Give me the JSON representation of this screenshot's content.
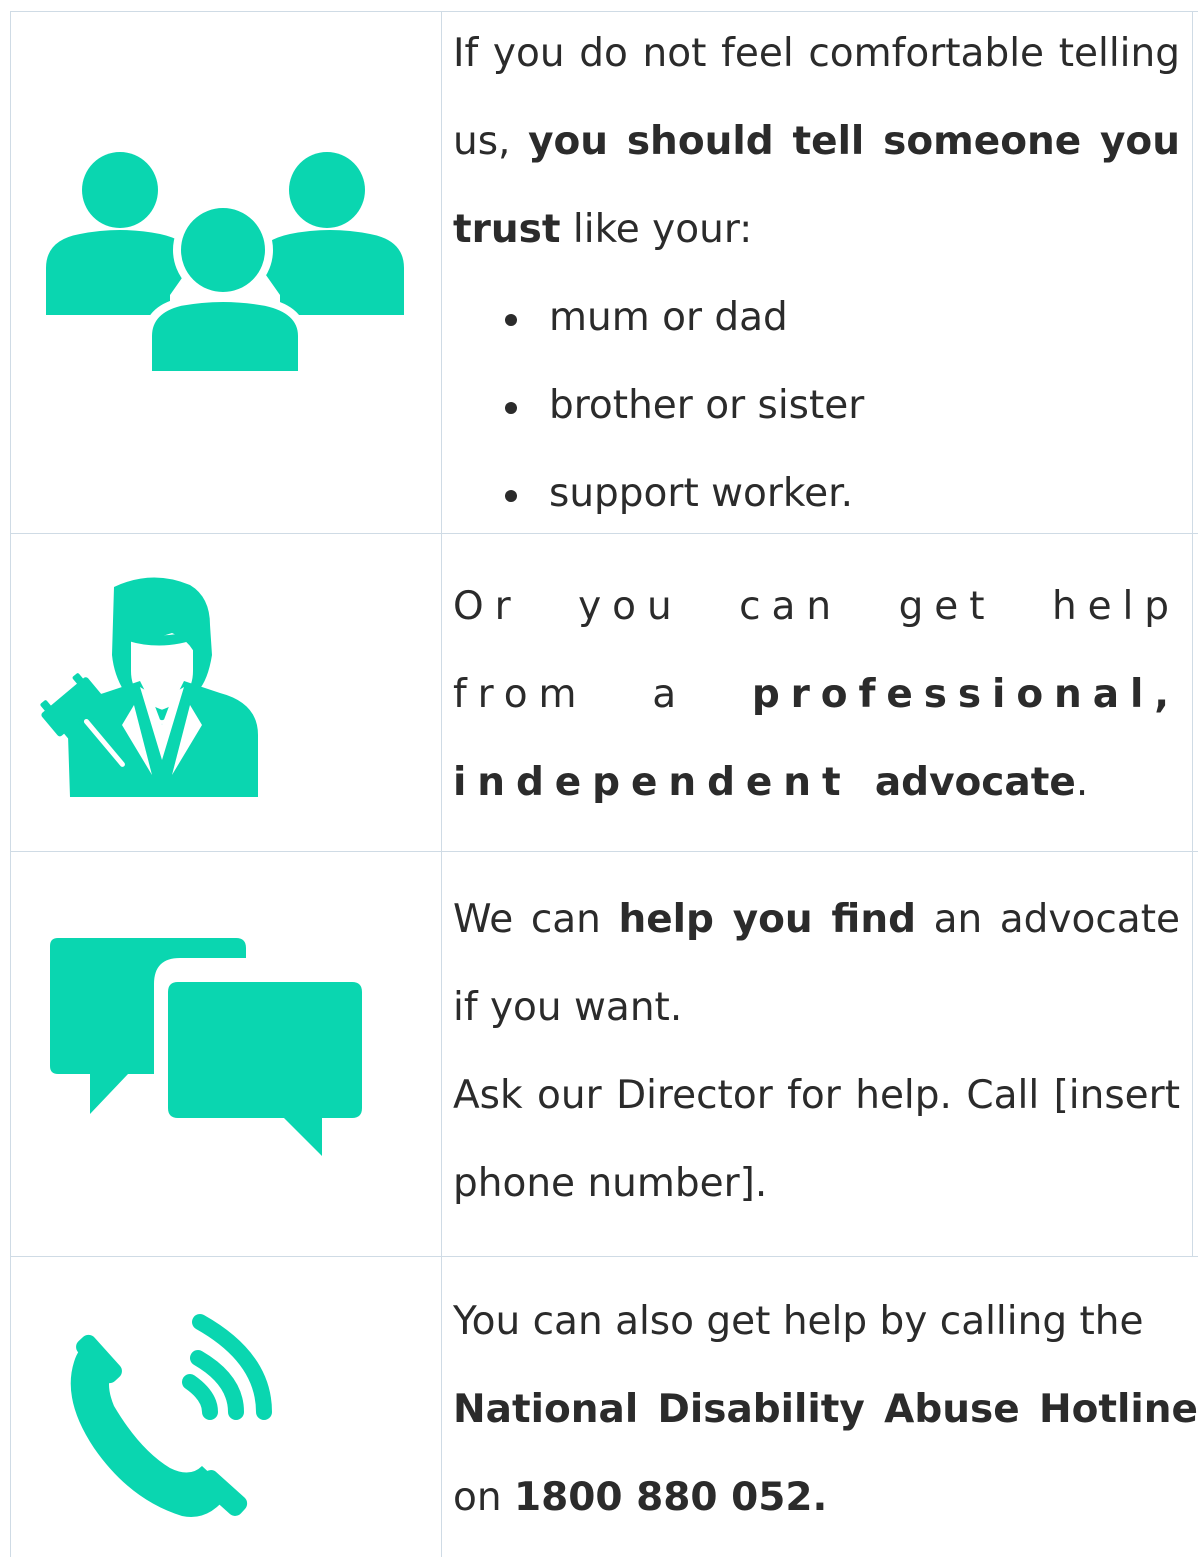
{
  "colors": {
    "accent": "#0ad6b0",
    "grid": "#cfdbe5",
    "text": "#2b2b2b"
  },
  "rows": [
    {
      "icon": "people-group-icon",
      "intro": "If you do not feel comfortable telling us,",
      "bold": "you should tell someone you trust",
      "tail": "like your:",
      "items": [
        "mum or dad",
        "brother or sister",
        "support worker."
      ]
    },
    {
      "icon": "advocate-icon",
      "intro": "Or you can get help from a",
      "bold1": "professional, independent",
      "bold2": "advocate",
      "tail": "."
    },
    {
      "icon": "speech-bubbles-icon",
      "pre": "We can",
      "bold": "help you find",
      "post": "an advocate if you want.",
      "line2": "Ask our Director for help. Call [insert phone number]."
    },
    {
      "icon": "phone-call-icon",
      "intro": "You can also get help by calling the",
      "bold": "National Disability Abuse Hotline",
      "pre2": "on",
      "phone": "1800 880 052."
    }
  ]
}
